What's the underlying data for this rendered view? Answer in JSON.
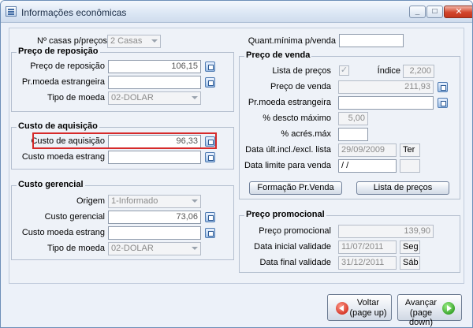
{
  "window": {
    "title": "Informações econômicas",
    "minimize_glyph": "_",
    "maximize_glyph": "□",
    "close_glyph": "✕"
  },
  "top": {
    "num_casas_label": "Nº casas p/preços",
    "num_casas_value": "2 Casas",
    "quant_minima_label": "Quant.mínima p/venda",
    "quant_minima_value": ""
  },
  "preco_reposicao": {
    "title": "Preço de reposição",
    "preco_label": "Preço de reposição",
    "preco_value": "106,15",
    "moeda_estrangeira_label": "Pr.moeda estrangeira",
    "moeda_estrangeira_value": "",
    "tipo_moeda_label": "Tipo de moeda",
    "tipo_moeda_value": "02-DOLAR"
  },
  "custo_aquisicao": {
    "title": "Custo de aquisição",
    "custo_label": "Custo de aquisição",
    "custo_value": "96,33",
    "moeda_label": "Custo moeda estrang",
    "moeda_value": ""
  },
  "custo_gerencial": {
    "title": "Custo gerencial",
    "origem_label": "Origem",
    "origem_value": "1-Informado",
    "custo_label": "Custo gerencial",
    "custo_value": "73,06",
    "moeda_label": "Custo moeda estrang",
    "moeda_value": "",
    "tipo_moeda_label": "Tipo de moeda",
    "tipo_moeda_value": "02-DOLAR"
  },
  "preco_venda": {
    "title": "Preço de venda",
    "lista_precos_label": "Lista de preços",
    "lista_precos_checked": "✓",
    "indice_label": "Índice",
    "indice_value": "2,200",
    "preco_label": "Preço de venda",
    "preco_value": "211,93",
    "moeda_label": "Pr.moeda estrangeira",
    "moeda_value": "",
    "desconto_label": "% descto máximo",
    "desconto_value": "5,00",
    "acrescimo_label": "% acrés.máx",
    "acrescimo_value": "",
    "data_ult_label": "Data últ.incl./excl. lista",
    "data_ult_value": "29/09/2009",
    "data_ult_day": "Ter",
    "data_limite_label": "Data limite para venda",
    "data_limite_value": " /  /",
    "data_limite_day": "",
    "formacao_button": "Formação Pr.Venda",
    "lista_button": "Lista de preços"
  },
  "preco_promocional": {
    "title": "Preço promocional",
    "preco_label": "Preço promocional",
    "preco_value": "139,90",
    "data_inicial_label": "Data inicial validade",
    "data_inicial_value": "11/07/2011",
    "data_inicial_day": "Seg",
    "data_final_label": "Data final validade",
    "data_final_value": "31/12/2011",
    "data_final_day": "Sáb"
  },
  "nav": {
    "voltar_line1": "Voltar",
    "voltar_line2": "(page up)",
    "avancar_line1": "Avançar",
    "avancar_line2": "(page down)"
  }
}
